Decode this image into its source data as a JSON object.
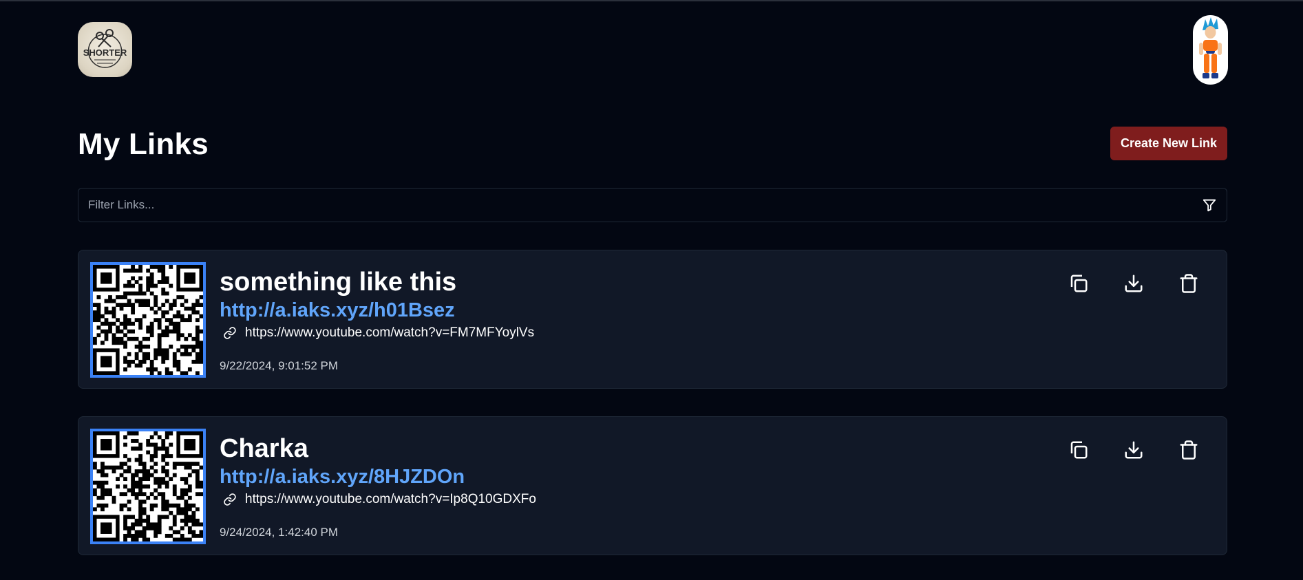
{
  "header": {
    "logo_text": "SHORTER",
    "logo_icon": "scissors-logo",
    "avatar_icon": "user-avatar"
  },
  "page": {
    "title": "My Links",
    "create_button_label": "Create New Link"
  },
  "filter": {
    "placeholder": "Filter Links...",
    "value": "",
    "icon": "filter-icon"
  },
  "links": [
    {
      "title": "something like this",
      "short_url": "http://a.iaks.xyz/h01Bsez",
      "long_url": "https://www.youtube.com/watch?v=FM7MFYoylVs",
      "created_at": "9/22/2024, 9:01:52 PM"
    },
    {
      "title": "Charka",
      "short_url": "http://a.iaks.xyz/8HJZDOn",
      "long_url": "https://www.youtube.com/watch?v=Ip8Q10GDXFo",
      "created_at": "9/24/2024, 1:42:40 PM"
    }
  ],
  "actions": {
    "copy_icon": "copy-icon",
    "download_icon": "download-icon",
    "delete_icon": "trash-icon"
  },
  "colors": {
    "background": "#030712",
    "card": "#111827",
    "accent_button": "#7f1d1d",
    "short_link": "#60a5fa",
    "qr_border": "#3b82f6"
  }
}
